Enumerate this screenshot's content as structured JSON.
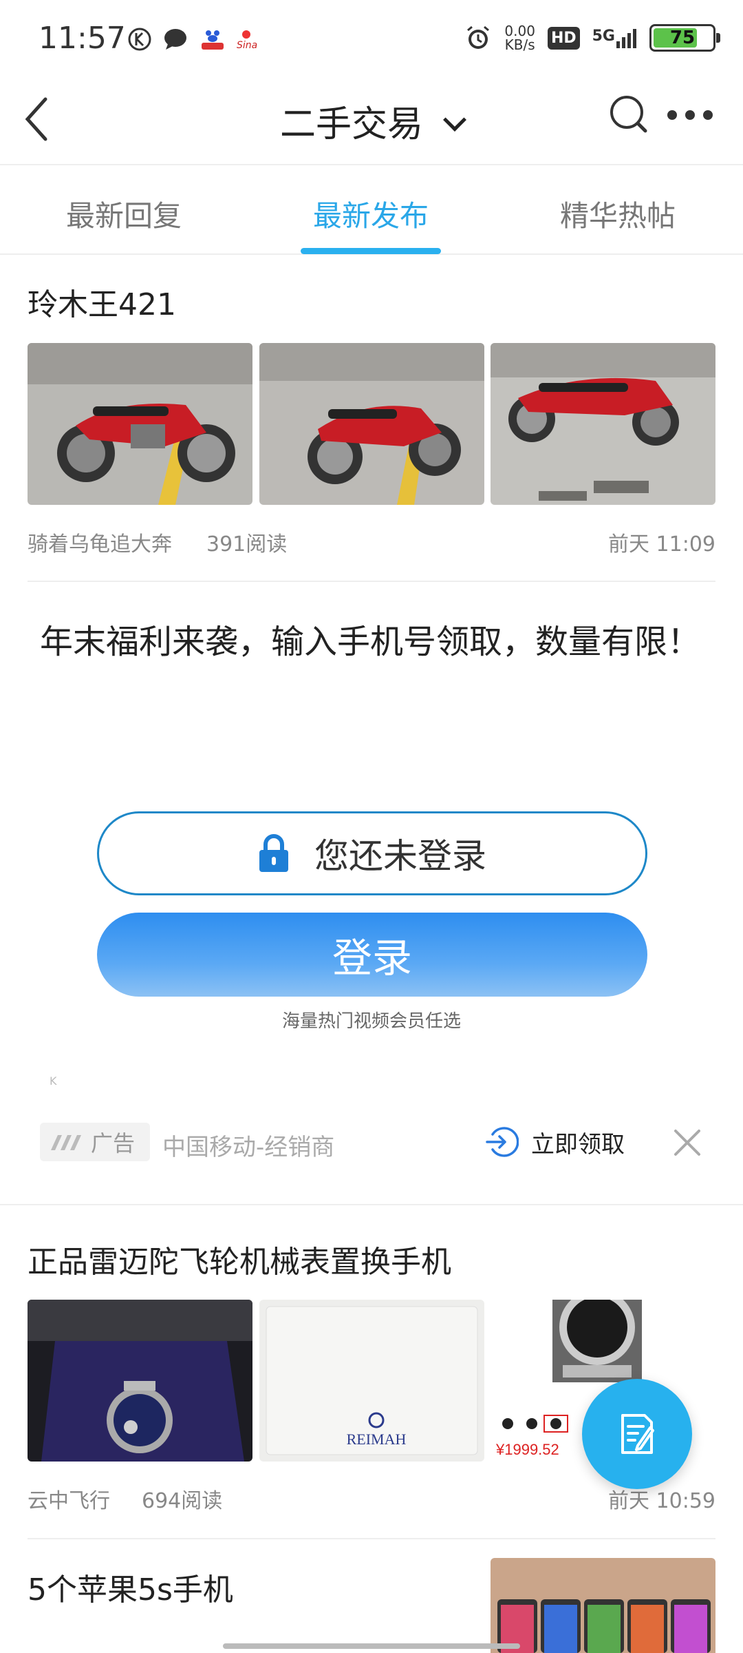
{
  "status_bar": {
    "time": "11:57",
    "net_speed_value": "0.00",
    "net_speed_unit": "KB/s",
    "hd": "HD",
    "signal": "5G",
    "battery": "75",
    "sina": "Sina"
  },
  "header": {
    "title": "二手交易"
  },
  "tabs": [
    {
      "label": "最新回复",
      "active": false
    },
    {
      "label": "最新发布",
      "active": true
    },
    {
      "label": "精华热帖",
      "active": false
    }
  ],
  "posts": [
    {
      "title": "玲木王421",
      "author": "骑着乌龟追大奔",
      "reads": "391阅读",
      "time": "前天 11:09"
    },
    {
      "title": "正品雷迈陀飞轮机械表置换手机",
      "author": "云中飞行",
      "reads": "694阅读",
      "time": "前天 10:59",
      "brand_text": "REIMAH",
      "price_text": "¥1999.52"
    },
    {
      "title": "5个苹果5s手机"
    }
  ],
  "ad": {
    "headline": "年末福利来袭，输入手机号领取，数量有限！",
    "login_hint": "您还未登录",
    "login_button": "登录",
    "sub_text": "海量热门视频会员任选",
    "tiny_mark": "K",
    "badge": "广告",
    "source": "中国移动-经销商",
    "claim": "立即领取"
  }
}
